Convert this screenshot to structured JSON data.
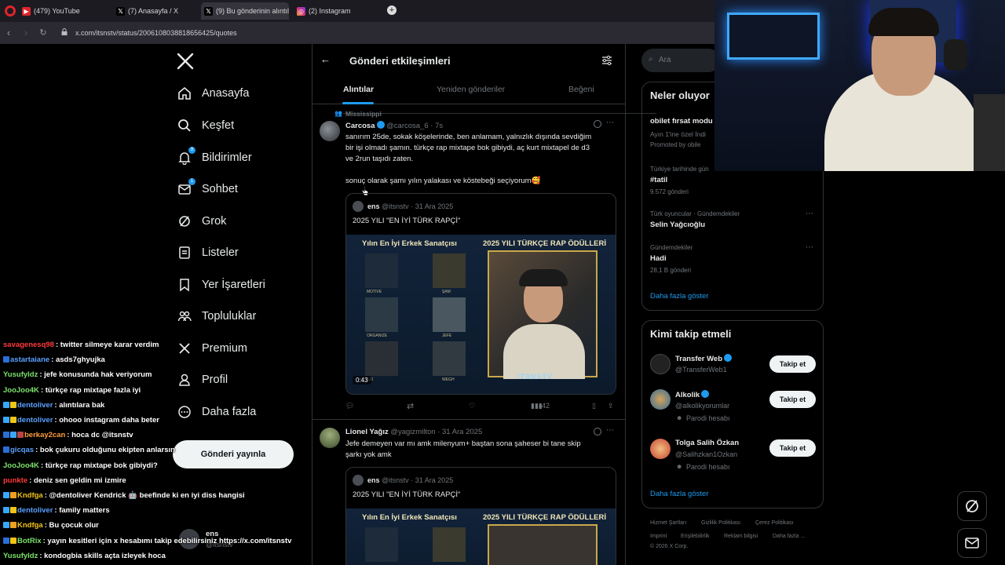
{
  "browser": {
    "tabs": [
      {
        "label": "(479) YouTube",
        "icon": "youtube-icon"
      },
      {
        "label": "(7) Anasayfa / X",
        "icon": "x-icon"
      },
      {
        "label": "(9) Bu gönderinin alıntıları",
        "icon": "x-icon"
      },
      {
        "label": "(2) Instagram",
        "icon": "instagram-icon"
      }
    ],
    "url": "x.com/itsnstv/status/2006108038818656425/quotes"
  },
  "sidebar": {
    "items": [
      {
        "label": "Anasayfa",
        "icon": "home-icon"
      },
      {
        "label": "Keşfet",
        "icon": "search-icon"
      },
      {
        "label": "Bildirimler",
        "icon": "bell-icon",
        "badge": "9"
      },
      {
        "label": "Sohbet",
        "icon": "mail-icon",
        "badge": "1"
      },
      {
        "label": "Grok",
        "icon": "grok-icon"
      },
      {
        "label": "Listeler",
        "icon": "list-icon"
      },
      {
        "label": "Yer İşaretleri",
        "icon": "bookmark-icon"
      },
      {
        "label": "Topluluklar",
        "icon": "communities-icon"
      },
      {
        "label": "Premium",
        "icon": "x-icon"
      },
      {
        "label": "Profil",
        "icon": "profile-icon"
      },
      {
        "label": "Daha fazla",
        "icon": "more-icon"
      }
    ],
    "post_button": "Gönderi yayınla",
    "account": {
      "name": "ens",
      "handle": "@itsnstv"
    }
  },
  "main": {
    "title": "Gönderi etkileşimleri",
    "tabs": [
      "Alıntılar",
      "Yeniden gönderiler",
      "Beğeni"
    ],
    "tweets": [
      {
        "context": "Mississippi",
        "name": "Carcosa",
        "handle": "@carcosa_6",
        "time": "· 7s",
        "text1": "sanırım 25de, sokak köşelerinde, ben anlamam, yalnızlık dışında sevdiğim",
        "text2": "bir işi olmadı şamın. türkçe rap mixtape bok gibiydi, aç kurt mixtapel de d3",
        "text3": "ve 2run taşıdı zaten.",
        "text4": "sonuç olarak şamı yılın yalakası ve köstebeği seçiyorum🥰",
        "quote": {
          "name": "ens",
          "handle": "@itsnstv",
          "time": "· 31 Ara 2025",
          "text": "2025 YILI \"EN İYİ TÜRK RAPÇİ\"",
          "video_time": "0:43"
        },
        "views": "42"
      },
      {
        "name": "Lionel Yağız",
        "handle": "@yagizmilton",
        "time": "· 31 Ara 2025",
        "text1": "Jefe demeyen var mı amk milenyum+ baştan sona şaheser bi tane skip",
        "text2": "şarkı yok amk",
        "quote": {
          "name": "ens",
          "handle": "@itsnstv",
          "time": "· 31 Ara 2025",
          "text": "2025 YILI \"EN İYİ TÜRK RAPÇİ\""
        }
      }
    ],
    "thumb": {
      "left_title": "Yılın En İyi Erkek Sanatçısı",
      "right_title": "2025 YILI TÜRKÇE RAP ÖDÜLLERİ",
      "artists": [
        "MOTIVE",
        "ŞAM",
        "ORGANIZE",
        "JEFE",
        "UZI",
        "WEGH"
      ],
      "watermark": "ITSNSTV"
    }
  },
  "right": {
    "search_placeholder": "Ara",
    "trends_title": "Neler oluyor",
    "promo": {
      "title": "obilet fırsat modu",
      "line": "Ayın 1'ine özel İndi",
      "promoted": "Promoted by obile"
    },
    "trends": [
      {
        "meta": "Türkiye tarihinde gün",
        "name": "#tatil",
        "count": "9.572 gönderi"
      },
      {
        "meta": "Türk oyuncular · Gündemdekiler",
        "name": "Selin Yağcıoğlu",
        "count": ""
      },
      {
        "meta": "Gündemdekiler",
        "name": "Hadi",
        "count": "28,1 B gönderi"
      }
    ],
    "show_more": "Daha fazla göster",
    "who_title": "Kimi takip etmeli",
    "who": [
      {
        "name": "Transfer Web",
        "handle": "@TransferWeb1",
        "sub": "",
        "button": "Takip et"
      },
      {
        "name": "Alkolik",
        "handle": "@alkolikyorumlar",
        "sub": "Parodi hesabı",
        "button": "Takip et"
      },
      {
        "name": "Tolga Salih Özkan",
        "handle": "@Salihzkan1Ozkan",
        "sub": "Parodi hesabı",
        "button": "Takip et"
      }
    ],
    "who_more": "Daha fazla göster",
    "footer1": [
      "Hizmet Şartları",
      "Gizlilik Politikası",
      "Çerez Politikası"
    ],
    "footer2": [
      "Imprint",
      "Erişilebilirlik",
      "Reklam bilgisi",
      "Daha fazla ..."
    ],
    "copyright": "© 2026 X Corp."
  },
  "chat": [
    {
      "user": "savagenesq98",
      "msg": ": twitter silmeye karar verdim",
      "color": "#ff3b3b",
      "badges": []
    },
    {
      "user": "astartaiane",
      "msg": ": asds7ghyujka",
      "color": "#5aa0ff",
      "badges": [
        "#2a6fd6"
      ]
    },
    {
      "user": "Yusufyldz",
      "msg": ": jefe konusunda hak veriyorum",
      "color": "#7be36a",
      "badges": []
    },
    {
      "user": "JooJoo4K",
      "msg": ": türkçe rap mixtape fazla iyi",
      "color": "#7be36a",
      "badges": []
    },
    {
      "user": "dentoliver",
      "msg": ": alıntılara bak",
      "color": "#5aa0ff",
      "badges": [
        "#3aa7ff",
        "#f0c419"
      ]
    },
    {
      "user": "dentoliver",
      "msg": ": ohooo instagram daha beter",
      "color": "#5aa0ff",
      "badges": [
        "#3aa7ff",
        "#f0c419"
      ]
    },
    {
      "user": "berkay2can",
      "msg": ": hoca dc @itsnstv",
      "color": "#ff9d3b",
      "badges": [
        "#2a6fd6",
        "#3aa7ff",
        "#b44"
      ]
    },
    {
      "user": "gicqas",
      "msg": ": bok çukuru olduğunu ekipten anlarsın",
      "color": "#5aa0ff",
      "badges": [
        "#2a6fd6"
      ]
    },
    {
      "user": "JooJoo4K",
      "msg": ": türkçe rap mixtape bok gibiydi?",
      "color": "#7be36a",
      "badges": []
    },
    {
      "user": "punkte",
      "msg": ": deniz sen geldin mi izmire",
      "color": "#ff3b3b",
      "badges": []
    },
    {
      "user": "Kndfga",
      "msg": ": @dentoliver Kendrick 🤖 beefinde ki en iyi diss hangisi",
      "color": "#f0c419",
      "badges": [
        "#3aa7ff",
        "#f0a020"
      ]
    },
    {
      "user": "dentoliver",
      "msg": ": family matters",
      "color": "#5aa0ff",
      "badges": [
        "#3aa7ff",
        "#f0c419"
      ]
    },
    {
      "user": "Kndfga",
      "msg": ": Bu çocuk olur",
      "color": "#f0c419",
      "badges": [
        "#3aa7ff",
        "#f0a020"
      ]
    },
    {
      "user": "BotRix",
      "msg": ": yayın kesitleri için x hesabımı takip edebilirsiniz https://x.com/itsnstv",
      "color": "#7be36a",
      "badges": [
        "#2a6fd6",
        "#f0c419"
      ]
    },
    {
      "user": "Yusufyldz",
      "msg": ": kondogbia skills açta izleyek hoca",
      "color": "#7be36a",
      "badges": []
    }
  ]
}
